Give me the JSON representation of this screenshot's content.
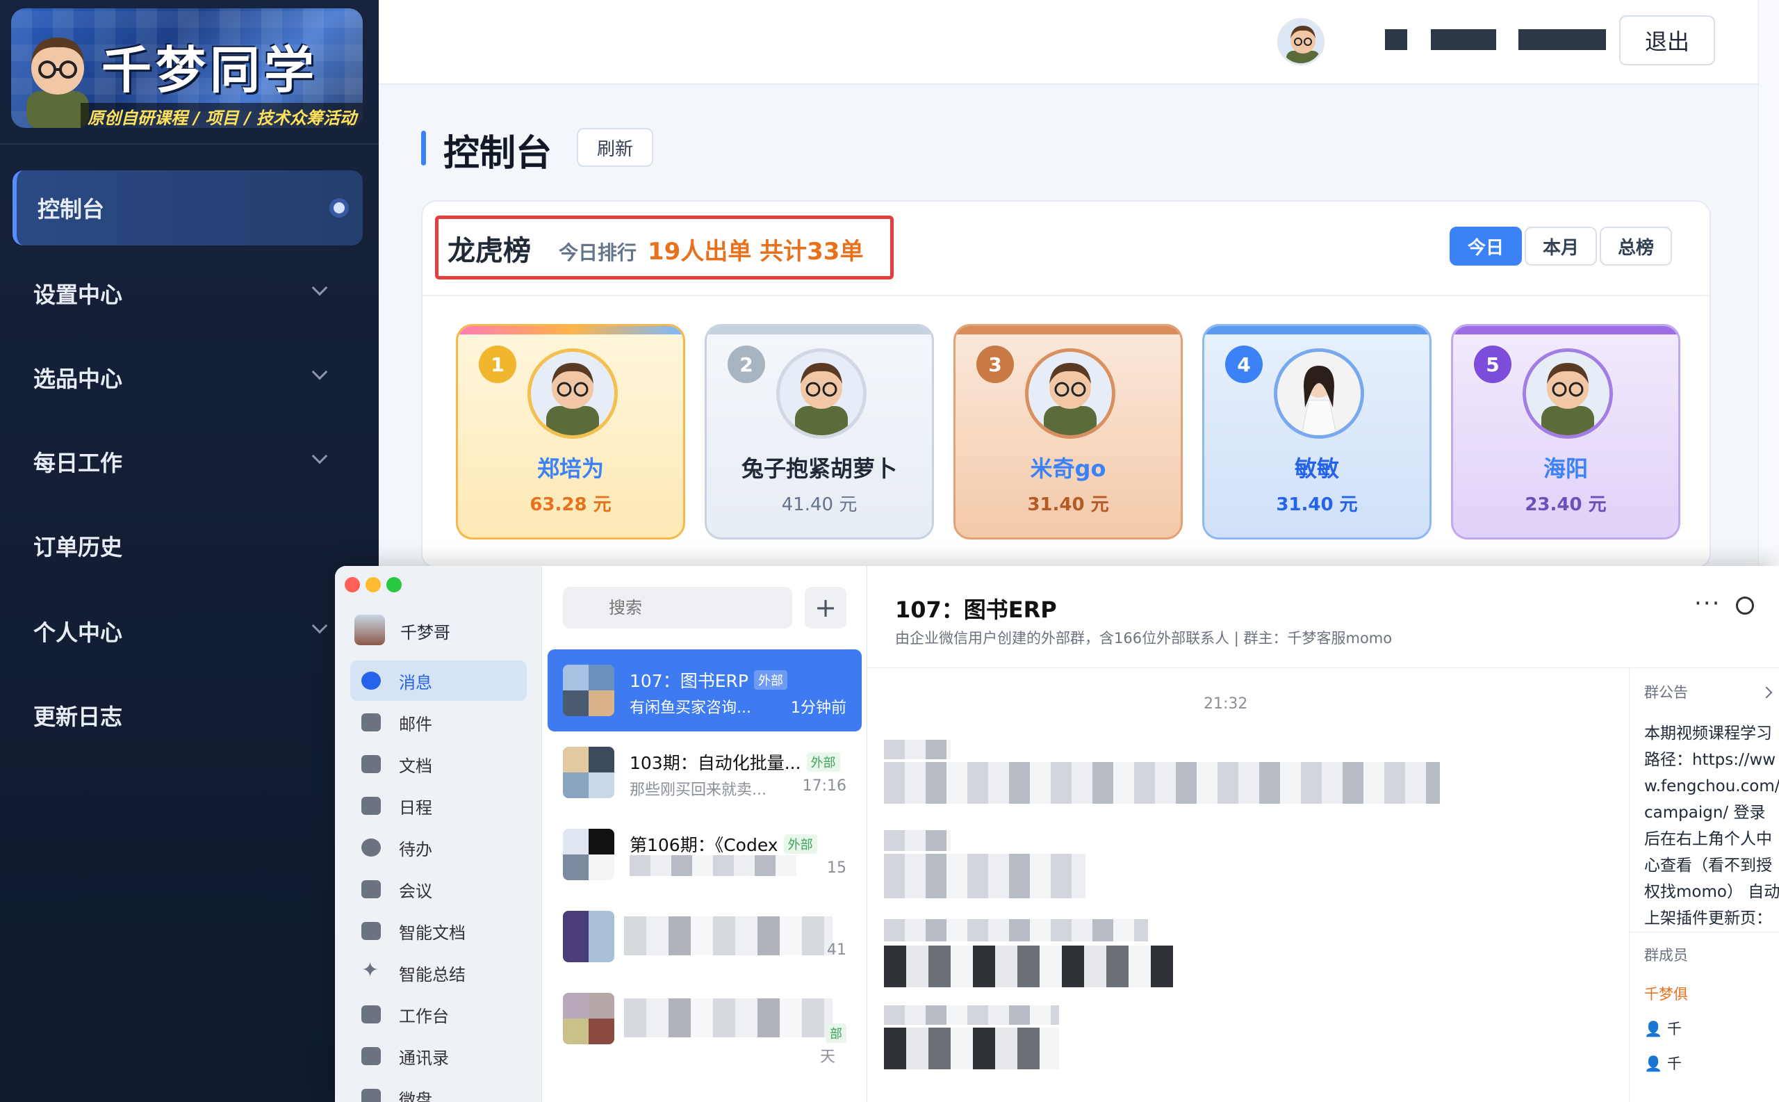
{
  "logo": {
    "title": "千梦同学",
    "subtitle": "原创自研课程 / 项目 / 技术众筹活动"
  },
  "sidebar": {
    "items": [
      {
        "label": "控制台"
      },
      {
        "label": "设置中心"
      },
      {
        "label": "选品中心"
      },
      {
        "label": "每日工作"
      },
      {
        "label": "订单历史"
      },
      {
        "label": "个人中心"
      },
      {
        "label": "更新日志"
      }
    ]
  },
  "topbar": {
    "logout_label": "退出"
  },
  "page": {
    "title": "控制台",
    "refresh_label": "刷新"
  },
  "leaderboard": {
    "title": "龙虎榜",
    "subtitle": "今日排行",
    "summary": "19人出单  共计33单",
    "tabs": [
      "今日",
      "本月",
      "总榜"
    ],
    "active_tab": "今日",
    "ranks": [
      {
        "rank": "1",
        "name": "郑培为",
        "amount": "63.28 元"
      },
      {
        "rank": "2",
        "name": "兔子抱紧胡萝卜",
        "amount": "41.40 元"
      },
      {
        "rank": "3",
        "name": "米奇go",
        "amount": "31.40 元"
      },
      {
        "rank": "4",
        "name": "敏敏",
        "amount": "31.40 元"
      },
      {
        "rank": "5",
        "name": "海阳",
        "amount": "23.40 元"
      }
    ]
  },
  "wecom": {
    "user_name": "千梦哥",
    "menu": [
      "消息",
      "邮件",
      "文档",
      "日程",
      "待办",
      "会议",
      "智能文档",
      "智能总结",
      "工作台",
      "通讯录",
      "微盘"
    ],
    "search_placeholder": "搜索",
    "add_label": "+",
    "conversations": [
      {
        "title": "107：图书ERP",
        "tag": "外部",
        "preview": "有闲鱼买家咨询...",
        "time": "1分钟前"
      },
      {
        "title": "103期：自动化批量...",
        "tag": "外部",
        "preview": "那些刚买回来就卖...",
        "time": "17:16"
      },
      {
        "title": "第106期：《Codex",
        "tag": "外部",
        "preview": "",
        "time": "15"
      },
      {
        "title": "",
        "tag": "",
        "preview": "",
        "time": "41"
      },
      {
        "title": "",
        "tag": "部",
        "preview": "",
        "time": "天"
      }
    ],
    "chat": {
      "title": "107：图书ERP",
      "description": "由企业微信用户创建的外部群，含166位外部联系人 | 群主：千梦客服momo",
      "more_label": "···",
      "time": "21:32"
    },
    "notice": {
      "label": "群公告",
      "text": "本期视频课程学习路径：https://www.fengchou.com/campaign/ 登录后在右上角个人中心查看（看不到授权找momo） 自动上架插件更新页：",
      "members_label": "群成员",
      "member_first": "千梦俱",
      "member_second": "千",
      "member_third": "千"
    }
  },
  "colors": {
    "accent": "#3b82f6",
    "orange": "#e8711d",
    "highlight_box": "#e53e3e",
    "sidebar_bg": "#17233c"
  }
}
